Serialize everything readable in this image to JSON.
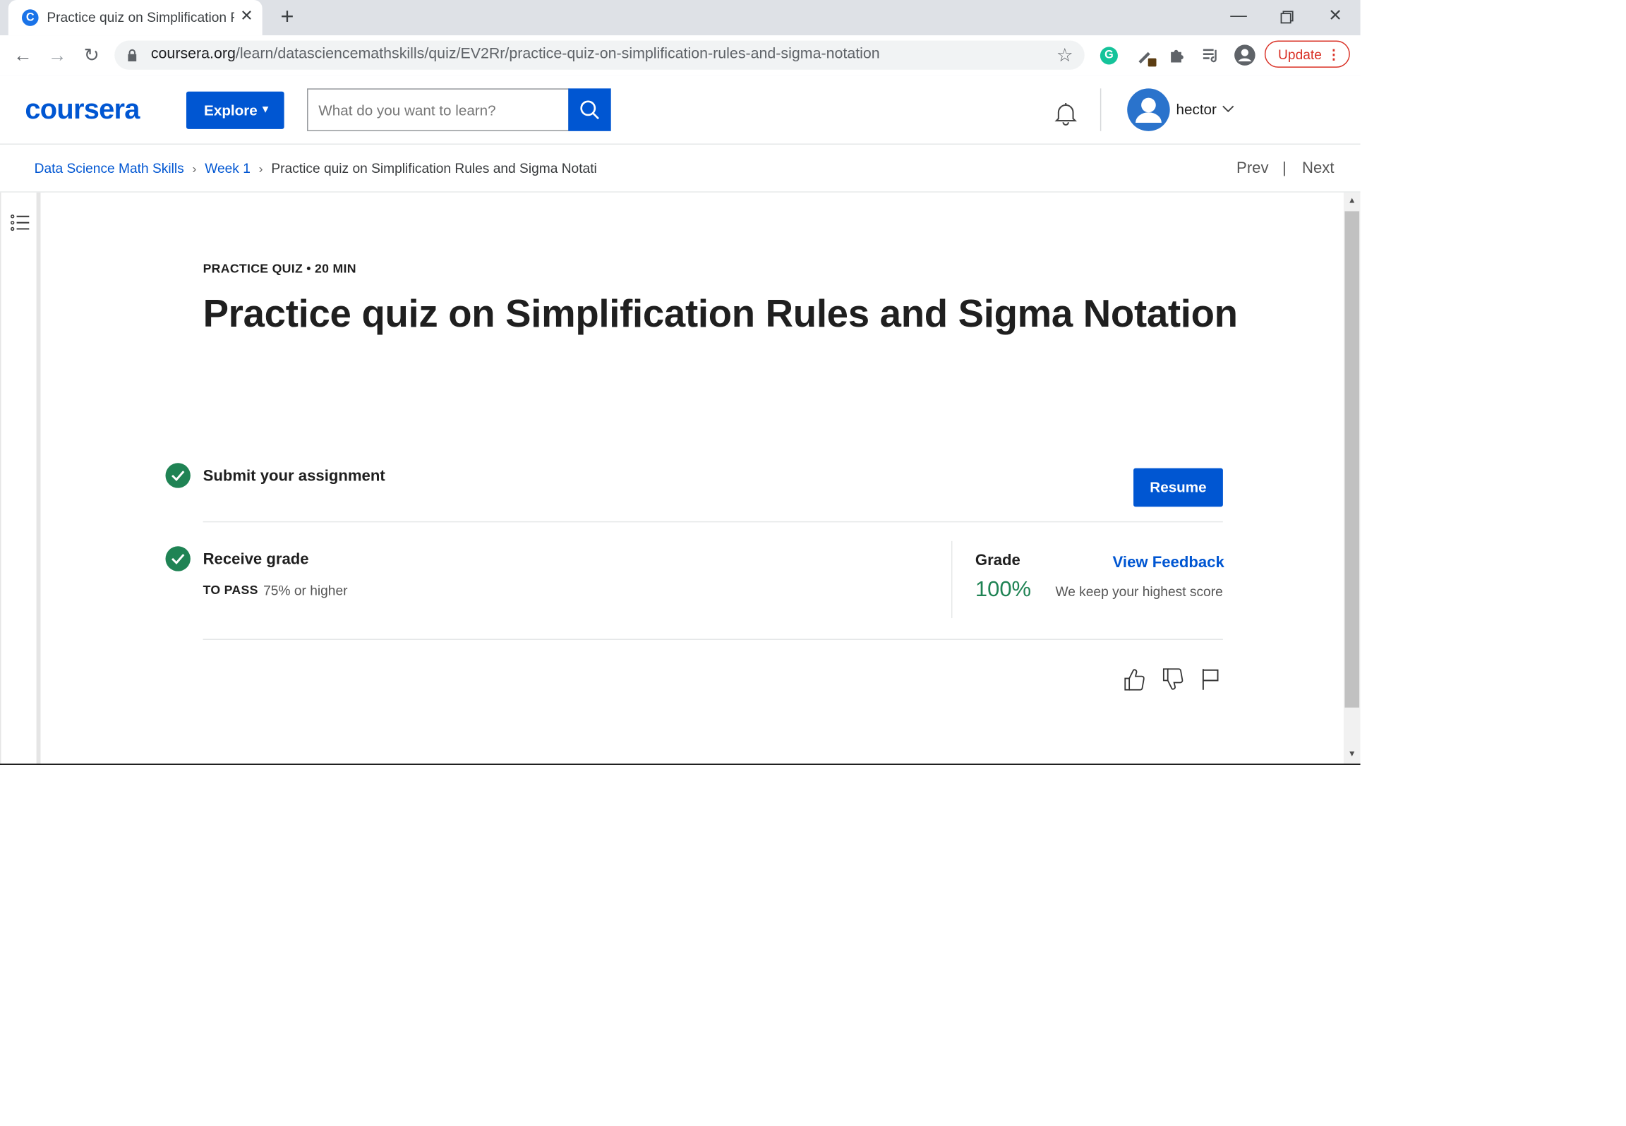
{
  "browser": {
    "tab_title": "Practice quiz on Simplification Rules and Sigma Notation",
    "favicon_letter": "C",
    "url_host": "coursera.org",
    "url_path": "/learn/datasciencemathskills/quiz/EV2Rr/practice-quiz-on-simplification-rules-and-sigma-notation",
    "update_label": "Update",
    "grammarly_letter": "G"
  },
  "header": {
    "logo": "coursera",
    "explore_label": "Explore",
    "search_placeholder": "What do you want to learn?",
    "username": "hector"
  },
  "breadcrumb": {
    "course": "Data Science Math Skills",
    "week": "Week 1",
    "current": "Practice quiz on Simplification Rules and Sigma Notati",
    "prev_label": "Prev",
    "separator": "|",
    "next_label": "Next"
  },
  "quiz": {
    "meta": "PRACTICE QUIZ • 20 MIN",
    "title": "Practice quiz on Simplification Rules and Sigma Notation",
    "step1_label": "Submit your assignment",
    "resume_label": "Resume",
    "step2_label": "Receive grade",
    "to_pass_label": "TO PASS",
    "to_pass_value": "75% or higher",
    "grade_label": "Grade",
    "grade_value": "100%",
    "view_feedback_label": "View Feedback",
    "keep_note": "We keep your highest score"
  },
  "colors": {
    "brand": "#0056d2",
    "success": "#1f8354"
  },
  "icons": {
    "feedback": [
      "thumbs-up-icon",
      "thumbs-down-icon",
      "flag-icon"
    ]
  }
}
